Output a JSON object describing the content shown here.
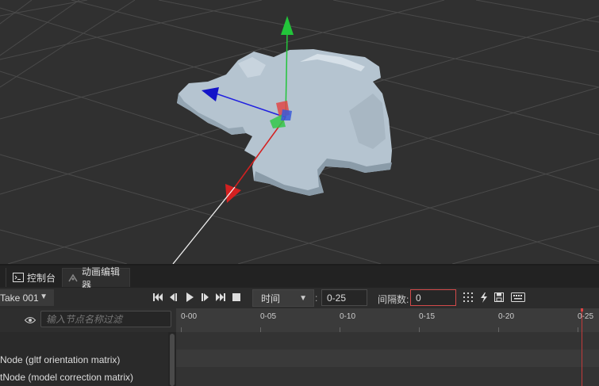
{
  "tabs": [
    {
      "label": "控制台",
      "icon": "console-icon"
    },
    {
      "label": "动画编辑器",
      "icon": "animation-icon"
    }
  ],
  "toolbar": {
    "clip": "Take 001",
    "time_mode": "时间",
    "time_value": "0-25",
    "interval_label": "间隔数:",
    "interval_value": "0"
  },
  "node_filter": {
    "placeholder": "输入节点名称过滤"
  },
  "timeline": {
    "ticks": [
      "0-00",
      "0-05",
      "0-10",
      "0-15",
      "0-20",
      "0-25"
    ],
    "playhead": "0-25"
  },
  "nodes": [
    {
      "label": "Node (gltf orientation matrix)"
    },
    {
      "label": "tNode (model correction matrix)"
    }
  ],
  "colors": {
    "axis_x": "#d42020",
    "axis_y": "#22c43a",
    "axis_z": "#1414c8",
    "model": "#b7c6d2",
    "playhead": "#c23a3a",
    "interval_border": "#d24a4a"
  }
}
